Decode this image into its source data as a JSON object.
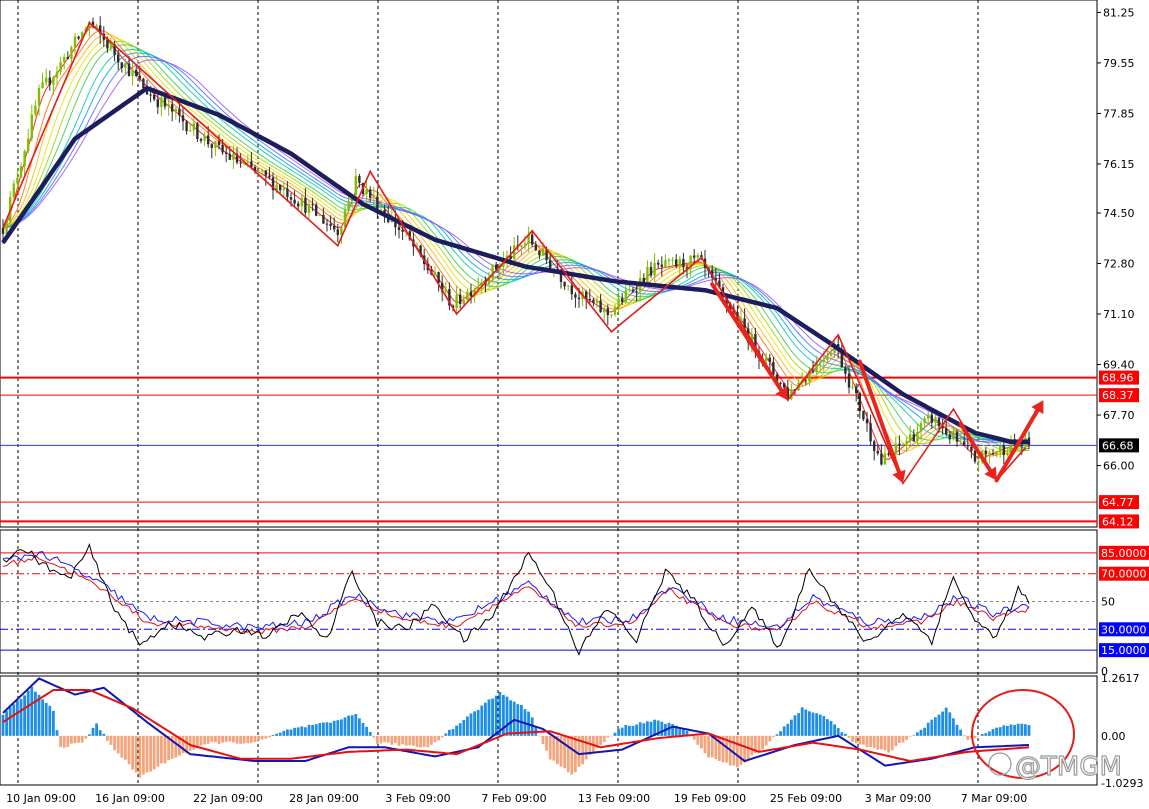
{
  "chart_data": [
    {
      "type": "candlestick",
      "title": "",
      "ylim": [
        64.0,
        81.6
      ],
      "y_ticks": [
        "81.25",
        "79.55",
        "77.85",
        "76.15",
        "74.50",
        "72.80",
        "71.10",
        "69.40",
        "67.70",
        "66.00"
      ],
      "x_ticks": [
        "10 Jan 09:00",
        "16 Jan 09:00",
        "22 Jan 09:00",
        "28 Jan 09:00",
        "3 Feb 09:00",
        "7 Feb 09:00",
        "13 Feb 09:00",
        "19 Feb 09:00",
        "25 Feb 09:00",
        "3 Mar 09:00",
        "7 Mar 09:00"
      ],
      "price_path": [
        {
          "i": 0,
          "v": 74.0
        },
        {
          "i": 10,
          "v": 78.5
        },
        {
          "i": 24,
          "v": 80.9
        },
        {
          "i": 40,
          "v": 78.6
        },
        {
          "i": 60,
          "v": 76.6
        },
        {
          "i": 78,
          "v": 75.3
        },
        {
          "i": 93,
          "v": 73.9
        },
        {
          "i": 98,
          "v": 75.6
        },
        {
          "i": 112,
          "v": 73.7
        },
        {
          "i": 125,
          "v": 71.4
        },
        {
          "i": 146,
          "v": 73.6
        },
        {
          "i": 160,
          "v": 71.7
        },
        {
          "i": 168,
          "v": 71.1
        },
        {
          "i": 180,
          "v": 72.6
        },
        {
          "i": 193,
          "v": 72.9
        },
        {
          "i": 208,
          "v": 70.2
        },
        {
          "i": 218,
          "v": 68.4
        },
        {
          "i": 231,
          "v": 70.1
        },
        {
          "i": 244,
          "v": 66.1
        },
        {
          "i": 258,
          "v": 67.6
        },
        {
          "i": 270,
          "v": 66.2
        },
        {
          "i": 280,
          "v": 66.7
        }
      ],
      "ma_path": [
        {
          "i": 0,
          "v": 73.5
        },
        {
          "i": 20,
          "v": 77.0
        },
        {
          "i": 40,
          "v": 78.7
        },
        {
          "i": 60,
          "v": 77.8
        },
        {
          "i": 80,
          "v": 76.5
        },
        {
          "i": 100,
          "v": 74.8
        },
        {
          "i": 120,
          "v": 73.6
        },
        {
          "i": 145,
          "v": 72.7
        },
        {
          "i": 170,
          "v": 72.2
        },
        {
          "i": 195,
          "v": 71.9
        },
        {
          "i": 215,
          "v": 71.3
        },
        {
          "i": 230,
          "v": 70.1
        },
        {
          "i": 250,
          "v": 68.4
        },
        {
          "i": 270,
          "v": 67.1
        },
        {
          "i": 280,
          "v": 66.8
        }
      ],
      "zigzag": [
        {
          "i": 0,
          "v": 74.0
        },
        {
          "i": 24,
          "v": 80.9
        },
        {
          "i": 93,
          "v": 73.4
        },
        {
          "i": 102,
          "v": 75.9
        },
        {
          "i": 126,
          "v": 71.1
        },
        {
          "i": 147,
          "v": 73.9
        },
        {
          "i": 169,
          "v": 70.5
        },
        {
          "i": 194,
          "v": 73.0
        },
        {
          "i": 218,
          "v": 68.2
        },
        {
          "i": 232,
          "v": 70.4
        },
        {
          "i": 250,
          "v": 65.4
        },
        {
          "i": 264,
          "v": 67.9
        },
        {
          "i": 276,
          "v": 65.5
        },
        {
          "i": 284,
          "v": 66.6
        }
      ],
      "arrows": [
        {
          "from": {
            "i": 197,
            "v": 72.1
          },
          "to": {
            "i": 218,
            "v": 68.2
          }
        },
        {
          "from": {
            "i": 238,
            "v": 69.5
          },
          "to": {
            "i": 250,
            "v": 65.4
          }
        },
        {
          "from": {
            "i": 266,
            "v": 67.4
          },
          "to": {
            "i": 276,
            "v": 65.5
          }
        },
        {
          "from": {
            "i": 276,
            "v": 65.5
          },
          "to": {
            "i": 289,
            "v": 68.2
          }
        }
      ],
      "levels": [
        {
          "label": "68.96",
          "value": 68.96,
          "color": "#ff0000",
          "tagged": true
        },
        {
          "label": "68.37",
          "value": 68.37,
          "color": "#ff0000",
          "tagged": true
        },
        {
          "label": "66.68",
          "value": 66.68,
          "color": "#2f2fff",
          "tagged": true,
          "current": true
        },
        {
          "label": "64.77",
          "value": 64.77,
          "color": "#ff0000",
          "tagged": true
        },
        {
          "label": "64.12",
          "value": 64.12,
          "color": "#ff0000",
          "tagged": true
        }
      ]
    },
    {
      "type": "line",
      "name": "stochastic",
      "ylim": [
        0,
        100
      ],
      "y_ticks": [
        "50",
        "0"
      ],
      "levels": [
        {
          "label": "85.0000",
          "value": 85,
          "color": "#ff0000"
        },
        {
          "label": "70.0000",
          "value": 70,
          "color": "#ff0000"
        },
        {
          "label": "30.0000",
          "value": 30,
          "color": "#0000ff"
        },
        {
          "label": "15.0000",
          "value": 15,
          "color": "#0000ff"
        }
      ],
      "main_path": [
        {
          "i": 0,
          "v": 80
        },
        {
          "i": 6,
          "v": 88
        },
        {
          "i": 12,
          "v": 75
        },
        {
          "i": 18,
          "v": 66
        },
        {
          "i": 24,
          "v": 88
        },
        {
          "i": 30,
          "v": 50
        },
        {
          "i": 38,
          "v": 18
        },
        {
          "i": 46,
          "v": 35
        },
        {
          "i": 56,
          "v": 24
        },
        {
          "i": 66,
          "v": 30
        },
        {
          "i": 74,
          "v": 25
        },
        {
          "i": 82,
          "v": 42
        },
        {
          "i": 90,
          "v": 22
        },
        {
          "i": 97,
          "v": 72
        },
        {
          "i": 104,
          "v": 35
        },
        {
          "i": 112,
          "v": 30
        },
        {
          "i": 120,
          "v": 48
        },
        {
          "i": 128,
          "v": 22
        },
        {
          "i": 136,
          "v": 40
        },
        {
          "i": 146,
          "v": 85
        },
        {
          "i": 152,
          "v": 60
        },
        {
          "i": 160,
          "v": 14
        },
        {
          "i": 168,
          "v": 45
        },
        {
          "i": 176,
          "v": 22
        },
        {
          "i": 184,
          "v": 72
        },
        {
          "i": 192,
          "v": 50
        },
        {
          "i": 200,
          "v": 18
        },
        {
          "i": 208,
          "v": 45
        },
        {
          "i": 216,
          "v": 16
        },
        {
          "i": 224,
          "v": 75
        },
        {
          "i": 232,
          "v": 45
        },
        {
          "i": 240,
          "v": 20
        },
        {
          "i": 250,
          "v": 42
        },
        {
          "i": 258,
          "v": 22
        },
        {
          "i": 264,
          "v": 68
        },
        {
          "i": 270,
          "v": 35
        },
        {
          "i": 276,
          "v": 25
        },
        {
          "i": 282,
          "v": 58
        },
        {
          "i": 285,
          "v": 50
        }
      ],
      "signal_path": [
        {
          "i": 0,
          "v": 76
        },
        {
          "i": 10,
          "v": 82
        },
        {
          "i": 20,
          "v": 70
        },
        {
          "i": 30,
          "v": 55
        },
        {
          "i": 40,
          "v": 35
        },
        {
          "i": 55,
          "v": 32
        },
        {
          "i": 70,
          "v": 28
        },
        {
          "i": 85,
          "v": 32
        },
        {
          "i": 97,
          "v": 52
        },
        {
          "i": 110,
          "v": 38
        },
        {
          "i": 125,
          "v": 32
        },
        {
          "i": 146,
          "v": 60
        },
        {
          "i": 160,
          "v": 32
        },
        {
          "i": 175,
          "v": 35
        },
        {
          "i": 185,
          "v": 58
        },
        {
          "i": 200,
          "v": 35
        },
        {
          "i": 215,
          "v": 28
        },
        {
          "i": 225,
          "v": 50
        },
        {
          "i": 240,
          "v": 32
        },
        {
          "i": 255,
          "v": 35
        },
        {
          "i": 265,
          "v": 50
        },
        {
          "i": 275,
          "v": 38
        },
        {
          "i": 285,
          "v": 45
        }
      ]
    },
    {
      "type": "bar",
      "name": "macd",
      "ylim": [
        -1.0293,
        1.2617
      ],
      "y_ticks": [
        "1.2617",
        "0.00",
        "-1.0293"
      ],
      "histogram_path": [
        {
          "i": 0,
          "v": 0.45
        },
        {
          "i": 8,
          "v": 1.05
        },
        {
          "i": 14,
          "v": 0.55
        },
        {
          "i": 16,
          "v": -0.25
        },
        {
          "i": 22,
          "v": -0.15
        },
        {
          "i": 26,
          "v": 0.25
        },
        {
          "i": 30,
          "v": -0.2
        },
        {
          "i": 38,
          "v": -0.9
        },
        {
          "i": 48,
          "v": -0.45
        },
        {
          "i": 58,
          "v": -0.15
        },
        {
          "i": 70,
          "v": -0.15
        },
        {
          "i": 80,
          "v": 0.15
        },
        {
          "i": 92,
          "v": 0.3
        },
        {
          "i": 98,
          "v": 0.5
        },
        {
          "i": 104,
          "v": -0.15
        },
        {
          "i": 118,
          "v": -0.25
        },
        {
          "i": 128,
          "v": 0.35
        },
        {
          "i": 138,
          "v": 0.95
        },
        {
          "i": 146,
          "v": 0.55
        },
        {
          "i": 152,
          "v": -0.5
        },
        {
          "i": 158,
          "v": -0.85
        },
        {
          "i": 166,
          "v": -0.2
        },
        {
          "i": 172,
          "v": 0.2
        },
        {
          "i": 182,
          "v": 0.35
        },
        {
          "i": 190,
          "v": 0.1
        },
        {
          "i": 196,
          "v": -0.45
        },
        {
          "i": 204,
          "v": -0.7
        },
        {
          "i": 212,
          "v": -0.2
        },
        {
          "i": 222,
          "v": 0.6
        },
        {
          "i": 230,
          "v": 0.35
        },
        {
          "i": 236,
          "v": -0.15
        },
        {
          "i": 246,
          "v": -0.35
        },
        {
          "i": 256,
          "v": 0.2
        },
        {
          "i": 262,
          "v": 0.6
        },
        {
          "i": 268,
          "v": -0.1
        },
        {
          "i": 276,
          "v": 0.2
        },
        {
          "i": 283,
          "v": 0.25
        }
      ],
      "macd_path": [
        {
          "i": 0,
          "v": 0.5
        },
        {
          "i": 10,
          "v": 1.25
        },
        {
          "i": 20,
          "v": 0.9
        },
        {
          "i": 28,
          "v": 1.05
        },
        {
          "i": 40,
          "v": 0.3
        },
        {
          "i": 52,
          "v": -0.4
        },
        {
          "i": 70,
          "v": -0.55
        },
        {
          "i": 84,
          "v": -0.55
        },
        {
          "i": 96,
          "v": -0.25
        },
        {
          "i": 106,
          "v": -0.25
        },
        {
          "i": 120,
          "v": -0.45
        },
        {
          "i": 132,
          "v": -0.25
        },
        {
          "i": 142,
          "v": 0.35
        },
        {
          "i": 150,
          "v": 0.15
        },
        {
          "i": 160,
          "v": -0.4
        },
        {
          "i": 172,
          "v": -0.3
        },
        {
          "i": 186,
          "v": 0.2
        },
        {
          "i": 196,
          "v": 0.05
        },
        {
          "i": 206,
          "v": -0.55
        },
        {
          "i": 220,
          "v": -0.2
        },
        {
          "i": 232,
          "v": 0.0
        },
        {
          "i": 245,
          "v": -0.65
        },
        {
          "i": 258,
          "v": -0.5
        },
        {
          "i": 270,
          "v": -0.25
        },
        {
          "i": 285,
          "v": -0.2
        }
      ],
      "signal_path": [
        {
          "i": 0,
          "v": 0.3
        },
        {
          "i": 14,
          "v": 1.0
        },
        {
          "i": 24,
          "v": 1.0
        },
        {
          "i": 36,
          "v": 0.6
        },
        {
          "i": 52,
          "v": -0.2
        },
        {
          "i": 66,
          "v": -0.5
        },
        {
          "i": 80,
          "v": -0.5
        },
        {
          "i": 96,
          "v": -0.35
        },
        {
          "i": 112,
          "v": -0.3
        },
        {
          "i": 126,
          "v": -0.4
        },
        {
          "i": 140,
          "v": 0.05
        },
        {
          "i": 152,
          "v": 0.1
        },
        {
          "i": 166,
          "v": -0.25
        },
        {
          "i": 182,
          "v": -0.05
        },
        {
          "i": 196,
          "v": 0.05
        },
        {
          "i": 210,
          "v": -0.35
        },
        {
          "i": 225,
          "v": -0.15
        },
        {
          "i": 238,
          "v": -0.3
        },
        {
          "i": 252,
          "v": -0.55
        },
        {
          "i": 268,
          "v": -0.35
        },
        {
          "i": 285,
          "v": -0.25
        }
      ]
    }
  ],
  "watermark": "@TMGM",
  "colors": {
    "bull": "#7fbf00",
    "bear": "#2d2d2d",
    "ma": "#1d1d5e",
    "zigzag": "#e31c1c",
    "arrow": "#e8241c",
    "hist_pos": "#1e8fe8",
    "hist_neg": "#f4a47c",
    "macd": "#1414b4",
    "macd_signal": "#e61010",
    "stoch_main": "#000000",
    "stoch_signal_blue": "#1a1aff",
    "stoch_signal_red": "#e61010",
    "grid": "#000000",
    "frame": "#000000",
    "circle": "#e31c1c"
  }
}
